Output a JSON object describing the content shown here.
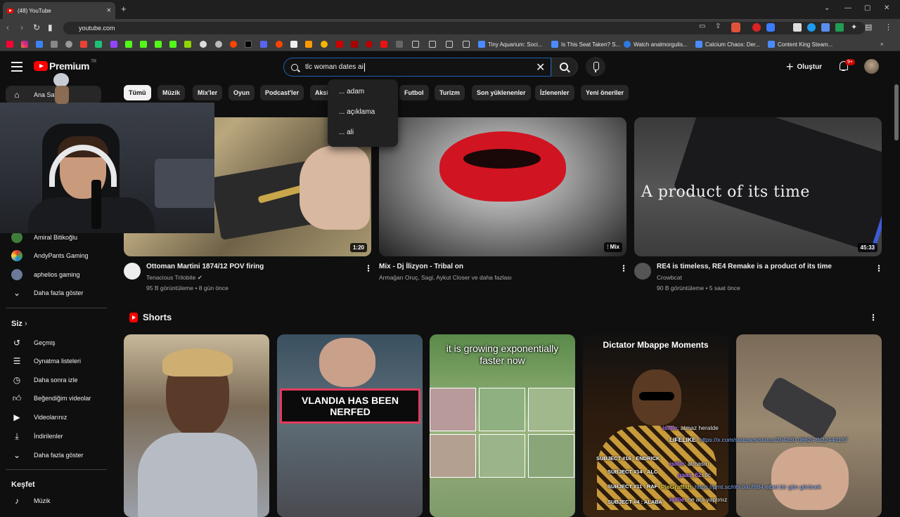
{
  "browser": {
    "tab_title": "(48) YouTube",
    "url": "youtube.com",
    "bookmarks": [
      "Tiny Aquarium: Soci...",
      "Is This Seat Taken? S...",
      "Watch analmorgulis...",
      "Calcium Chaos: Der...",
      "Content King Steam..."
    ]
  },
  "header": {
    "logo_text": "Premium",
    "logo_sup": "TR",
    "search_query": "tlc woman dates ai",
    "create_label": "Oluştur",
    "notif_count": "9+"
  },
  "suggestions": [
    "... adam",
    "... açıklama",
    "... ali"
  ],
  "chips": [
    "Tümü",
    "Müzik",
    "Mix'ler",
    "Oyun",
    "Podcast'ler",
    "Aksi",
    "Futbol",
    "Turizm",
    "Son yüklenenler",
    "İzlenenler",
    "Yeni öneriler"
  ],
  "sidebar": {
    "home": "Ana Sayfa",
    "channels": [
      "Amiral Bitikoğlu",
      "AndyPants Gaming",
      "aphelios gaming"
    ],
    "show_more_1": "Daha fazla göster",
    "you_heading": "Siz",
    "you_items": [
      "Geçmiş",
      "Oynatma listeleri",
      "Daha sonra izle",
      "Beğendiğim videolar",
      "Videolarınız",
      "İndirilenler",
      "Daha fazla göster"
    ],
    "explore_heading": "Keşfet",
    "explore_items": [
      "Müzik"
    ]
  },
  "videos": [
    {
      "title": "Ottoman Martini 1874/12 POV firing",
      "channel": "Tenacious Trilobite",
      "meta": "95 B görüntüleme • 8 gün önce",
      "duration": "1:20"
    },
    {
      "title": "Mix - Dj İlizyon - Tribal on",
      "channel": "Armağan Oruç, Sagi, Aykut Closer ve daha fazlası",
      "meta": "",
      "duration": "Mix"
    },
    {
      "title": "RE4 is timeless, RE4 Remake is a product of its time",
      "channel": "Crowbcat",
      "meta": "90 B görüntüleme • 5 saat önce",
      "duration": "45:33",
      "thumb_text": "A product of its time"
    }
  ],
  "shorts": {
    "heading": "Shorts",
    "items": [
      {
        "text": ""
      },
      {
        "text": "VLANDIA HAS BEEN NERFED"
      },
      {
        "text": "it is growing exponentially faster now"
      },
      {
        "text": "Dictator Mbappe Moments"
      },
      {
        "text": ""
      }
    ]
  },
  "chat": [
    {
      "user": "isillie",
      "msg": ": atmaz heralde"
    },
    {
      "user": "LIFELIKE",
      "msg": ": https://x.com/statuses/status/204230 08624 9/22440137"
    },
    {
      "user": "isillie",
      "msg": ": atmasın"
    },
    {
      "user": "gaaa_62",
      "msg": ": tlc"
    },
    {
      "user": "PieGraffith",
      "msg": ": https://prnt.sc/ri6l 9a/7884 elbet bir gün görücek"
    },
    {
      "user": "isillie",
      "msg": ": ne ara yaptınız"
    }
  ],
  "chat_overlay_labels": [
    "SUBJECT #16 : ENDRICK",
    "SUBJECT #14 : ALC",
    "SUBJECT #11 : RAF",
    "SUBJECT #4 : ALABA"
  ]
}
